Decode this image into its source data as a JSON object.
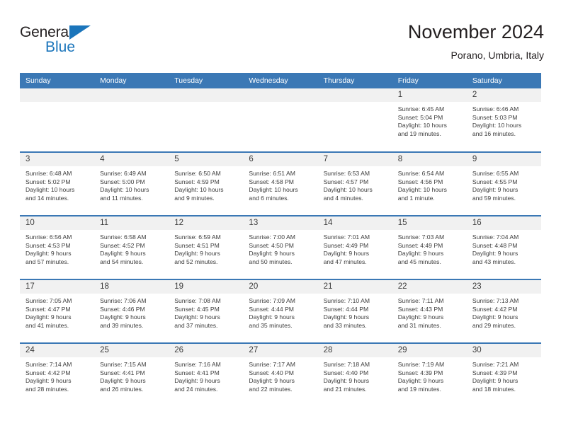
{
  "logo": {
    "word_general": "General",
    "word_blue": "Blue",
    "triangle_color": "#1b75bb"
  },
  "header": {
    "title": "November 2024",
    "subtitle": "Porano, Umbria, Italy"
  },
  "theme": {
    "header_blue": "#3b78b5",
    "band_gray": "#f1f1f1",
    "text_dark": "#3c3c3c"
  },
  "weekdays": [
    "Sunday",
    "Monday",
    "Tuesday",
    "Wednesday",
    "Thursday",
    "Friday",
    "Saturday"
  ],
  "labels": {
    "sunrise_prefix": "Sunrise:",
    "sunset_prefix": "Sunset:",
    "daylight_prefix": "Daylight:"
  },
  "weeks": [
    [
      {
        "day": "",
        "empty": true
      },
      {
        "day": "",
        "empty": true
      },
      {
        "day": "",
        "empty": true
      },
      {
        "day": "",
        "empty": true
      },
      {
        "day": "",
        "empty": true
      },
      {
        "day": "1",
        "sunrise": "Sunrise: 6:45 AM",
        "sunset": "Sunset: 5:04 PM",
        "daylight1": "Daylight: 10 hours",
        "daylight2": "and 19 minutes."
      },
      {
        "day": "2",
        "sunrise": "Sunrise: 6:46 AM",
        "sunset": "Sunset: 5:03 PM",
        "daylight1": "Daylight: 10 hours",
        "daylight2": "and 16 minutes."
      }
    ],
    [
      {
        "day": "3",
        "sunrise": "Sunrise: 6:48 AM",
        "sunset": "Sunset: 5:02 PM",
        "daylight1": "Daylight: 10 hours",
        "daylight2": "and 14 minutes."
      },
      {
        "day": "4",
        "sunrise": "Sunrise: 6:49 AM",
        "sunset": "Sunset: 5:00 PM",
        "daylight1": "Daylight: 10 hours",
        "daylight2": "and 11 minutes."
      },
      {
        "day": "5",
        "sunrise": "Sunrise: 6:50 AM",
        "sunset": "Sunset: 4:59 PM",
        "daylight1": "Daylight: 10 hours",
        "daylight2": "and 9 minutes."
      },
      {
        "day": "6",
        "sunrise": "Sunrise: 6:51 AM",
        "sunset": "Sunset: 4:58 PM",
        "daylight1": "Daylight: 10 hours",
        "daylight2": "and 6 minutes."
      },
      {
        "day": "7",
        "sunrise": "Sunrise: 6:53 AM",
        "sunset": "Sunset: 4:57 PM",
        "daylight1": "Daylight: 10 hours",
        "daylight2": "and 4 minutes."
      },
      {
        "day": "8",
        "sunrise": "Sunrise: 6:54 AM",
        "sunset": "Sunset: 4:56 PM",
        "daylight1": "Daylight: 10 hours",
        "daylight2": "and 1 minute."
      },
      {
        "day": "9",
        "sunrise": "Sunrise: 6:55 AM",
        "sunset": "Sunset: 4:55 PM",
        "daylight1": "Daylight: 9 hours",
        "daylight2": "and 59 minutes."
      }
    ],
    [
      {
        "day": "10",
        "sunrise": "Sunrise: 6:56 AM",
        "sunset": "Sunset: 4:53 PM",
        "daylight1": "Daylight: 9 hours",
        "daylight2": "and 57 minutes."
      },
      {
        "day": "11",
        "sunrise": "Sunrise: 6:58 AM",
        "sunset": "Sunset: 4:52 PM",
        "daylight1": "Daylight: 9 hours",
        "daylight2": "and 54 minutes."
      },
      {
        "day": "12",
        "sunrise": "Sunrise: 6:59 AM",
        "sunset": "Sunset: 4:51 PM",
        "daylight1": "Daylight: 9 hours",
        "daylight2": "and 52 minutes."
      },
      {
        "day": "13",
        "sunrise": "Sunrise: 7:00 AM",
        "sunset": "Sunset: 4:50 PM",
        "daylight1": "Daylight: 9 hours",
        "daylight2": "and 50 minutes."
      },
      {
        "day": "14",
        "sunrise": "Sunrise: 7:01 AM",
        "sunset": "Sunset: 4:49 PM",
        "daylight1": "Daylight: 9 hours",
        "daylight2": "and 47 minutes."
      },
      {
        "day": "15",
        "sunrise": "Sunrise: 7:03 AM",
        "sunset": "Sunset: 4:49 PM",
        "daylight1": "Daylight: 9 hours",
        "daylight2": "and 45 minutes."
      },
      {
        "day": "16",
        "sunrise": "Sunrise: 7:04 AM",
        "sunset": "Sunset: 4:48 PM",
        "daylight1": "Daylight: 9 hours",
        "daylight2": "and 43 minutes."
      }
    ],
    [
      {
        "day": "17",
        "sunrise": "Sunrise: 7:05 AM",
        "sunset": "Sunset: 4:47 PM",
        "daylight1": "Daylight: 9 hours",
        "daylight2": "and 41 minutes."
      },
      {
        "day": "18",
        "sunrise": "Sunrise: 7:06 AM",
        "sunset": "Sunset: 4:46 PM",
        "daylight1": "Daylight: 9 hours",
        "daylight2": "and 39 minutes."
      },
      {
        "day": "19",
        "sunrise": "Sunrise: 7:08 AM",
        "sunset": "Sunset: 4:45 PM",
        "daylight1": "Daylight: 9 hours",
        "daylight2": "and 37 minutes."
      },
      {
        "day": "20",
        "sunrise": "Sunrise: 7:09 AM",
        "sunset": "Sunset: 4:44 PM",
        "daylight1": "Daylight: 9 hours",
        "daylight2": "and 35 minutes."
      },
      {
        "day": "21",
        "sunrise": "Sunrise: 7:10 AM",
        "sunset": "Sunset: 4:44 PM",
        "daylight1": "Daylight: 9 hours",
        "daylight2": "and 33 minutes."
      },
      {
        "day": "22",
        "sunrise": "Sunrise: 7:11 AM",
        "sunset": "Sunset: 4:43 PM",
        "daylight1": "Daylight: 9 hours",
        "daylight2": "and 31 minutes."
      },
      {
        "day": "23",
        "sunrise": "Sunrise: 7:13 AM",
        "sunset": "Sunset: 4:42 PM",
        "daylight1": "Daylight: 9 hours",
        "daylight2": "and 29 minutes."
      }
    ],
    [
      {
        "day": "24",
        "sunrise": "Sunrise: 7:14 AM",
        "sunset": "Sunset: 4:42 PM",
        "daylight1": "Daylight: 9 hours",
        "daylight2": "and 28 minutes."
      },
      {
        "day": "25",
        "sunrise": "Sunrise: 7:15 AM",
        "sunset": "Sunset: 4:41 PM",
        "daylight1": "Daylight: 9 hours",
        "daylight2": "and 26 minutes."
      },
      {
        "day": "26",
        "sunrise": "Sunrise: 7:16 AM",
        "sunset": "Sunset: 4:41 PM",
        "daylight1": "Daylight: 9 hours",
        "daylight2": "and 24 minutes."
      },
      {
        "day": "27",
        "sunrise": "Sunrise: 7:17 AM",
        "sunset": "Sunset: 4:40 PM",
        "daylight1": "Daylight: 9 hours",
        "daylight2": "and 22 minutes."
      },
      {
        "day": "28",
        "sunrise": "Sunrise: 7:18 AM",
        "sunset": "Sunset: 4:40 PM",
        "daylight1": "Daylight: 9 hours",
        "daylight2": "and 21 minutes."
      },
      {
        "day": "29",
        "sunrise": "Sunrise: 7:19 AM",
        "sunset": "Sunset: 4:39 PM",
        "daylight1": "Daylight: 9 hours",
        "daylight2": "and 19 minutes."
      },
      {
        "day": "30",
        "sunrise": "Sunrise: 7:21 AM",
        "sunset": "Sunset: 4:39 PM",
        "daylight1": "Daylight: 9 hours",
        "daylight2": "and 18 minutes."
      }
    ]
  ]
}
